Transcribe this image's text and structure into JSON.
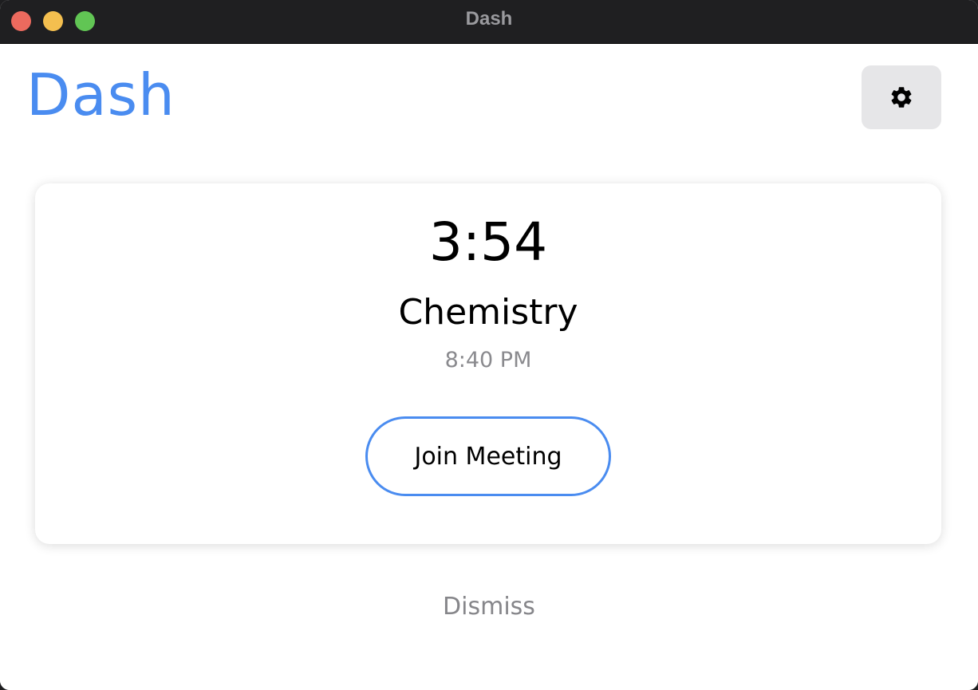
{
  "window": {
    "title": "Dash",
    "controls": {
      "close_color": "#ec6a5e",
      "minimize_color": "#f4bf4f",
      "zoom_color": "#61c554"
    }
  },
  "header": {
    "app_title": "Dash",
    "settings_icon": "gear-icon"
  },
  "meeting_card": {
    "countdown": "3:54",
    "name": "Chemistry",
    "time": "8:40 PM",
    "join_label": "Join Meeting"
  },
  "footer": {
    "dismiss_label": "Dismiss"
  },
  "colors": {
    "accent": "#4a8cf0",
    "secondary_text": "#8a8a8e",
    "settings_bg": "#e6e6e8"
  }
}
